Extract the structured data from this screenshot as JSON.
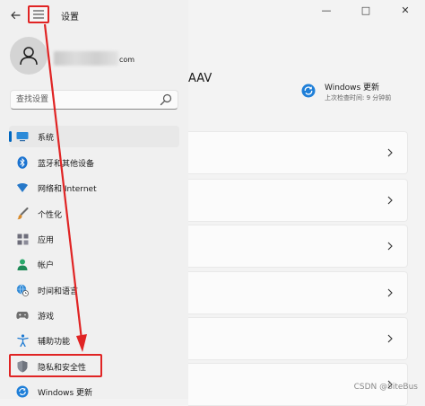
{
  "window": {
    "title": "设置",
    "controls": {
      "minimize": "—",
      "maximize": "□",
      "close": "✕"
    }
  },
  "account": {
    "email_suffix": "com"
  },
  "search": {
    "placeholder": "查找设置"
  },
  "nav": {
    "items": [
      {
        "label": "系统",
        "icon": "monitor-icon",
        "active": true
      },
      {
        "label": "蓝牙和其他设备",
        "icon": "bluetooth-icon",
        "active": false
      },
      {
        "label": "网络和 Internet",
        "icon": "wifi-icon",
        "active": false
      },
      {
        "label": "个性化",
        "icon": "brush-icon",
        "active": false
      },
      {
        "label": "应用",
        "icon": "apps-icon",
        "active": false
      },
      {
        "label": "帐户",
        "icon": "person-icon",
        "active": false
      },
      {
        "label": "时间和语言",
        "icon": "globe-clock-icon",
        "active": false
      },
      {
        "label": "游戏",
        "icon": "gamepad-icon",
        "active": false
      },
      {
        "label": "辅助功能",
        "icon": "accessibility-icon",
        "active": false
      },
      {
        "label": "隐私和安全性",
        "icon": "shield-icon",
        "active": false
      },
      {
        "label": "Windows 更新",
        "icon": "windows-update-icon",
        "active": false
      }
    ]
  },
  "main": {
    "heading_partial": "AAV",
    "update_tile": {
      "title": "Windows 更新",
      "subtitle": "上次检查时间: 9 分钟前"
    }
  },
  "watermark": "CSDN @SiteBus",
  "colors": {
    "accent": "#0067c0",
    "annotation_red": "#e02424",
    "nav_background": "#f0f0f0",
    "card_background": "#fbfbfb"
  }
}
